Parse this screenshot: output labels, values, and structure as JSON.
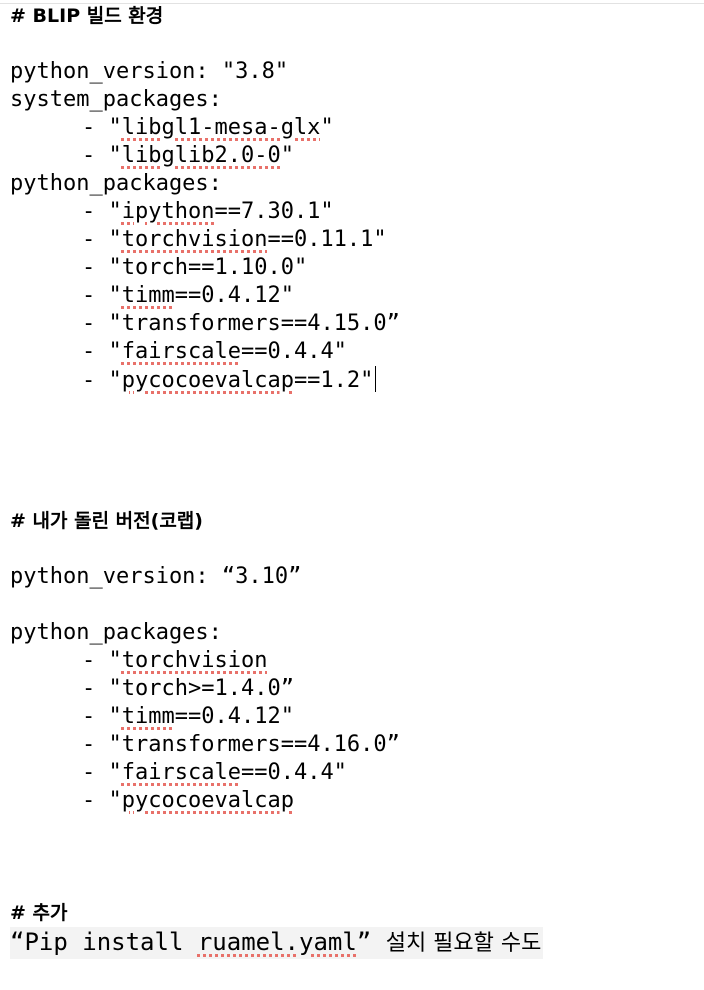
{
  "section1": {
    "heading": "# BLIP 빌드 환경",
    "python_version_line": "python_version: \"3.8\"",
    "system_packages_label": "system_packages:",
    "system_packages": [
      {
        "prefix": "- \"",
        "name": "libgl1-mesa-glx",
        "suffix": "\""
      },
      {
        "prefix": "- \"",
        "name": "libglib2.0-0",
        "suffix": "\""
      }
    ],
    "python_packages_label": "python_packages:",
    "python_packages": [
      {
        "prefix": "- \"",
        "name": "ipython",
        "suffix": "==7.30.1\""
      },
      {
        "prefix": "- \"",
        "name": "torchvision",
        "suffix": "==0.11.1\""
      },
      {
        "prefix": "- \"",
        "name": "torch",
        "suffix": "==1.10.0\""
      },
      {
        "prefix": "- \"",
        "name": "timm",
        "suffix": "==0.4.12\""
      },
      {
        "prefix": "- \"",
        "name": "transformers",
        "suffix": "==4.15.0”"
      },
      {
        "prefix": "- \"",
        "name": "fairscale",
        "suffix": "==0.4.4\""
      },
      {
        "prefix": "- \"",
        "name": "pycocoevalcap",
        "suffix": "==1.2\""
      }
    ]
  },
  "section2": {
    "heading": "# 내가 돌린 버전(코랩)",
    "python_version_line": "python_version: “3.10”",
    "python_packages_label": "python_packages:",
    "python_packages": [
      {
        "prefix": "- \"",
        "name": "torchvision",
        "suffix": ""
      },
      {
        "prefix": "- \"",
        "name": "torch",
        "suffix": ">=1.4.0”"
      },
      {
        "prefix": "- \"",
        "name": "timm",
        "suffix": "==0.4.12\""
      },
      {
        "prefix": "- \"",
        "name": "transformers",
        "suffix": "==4.16.0”"
      },
      {
        "prefix": "- \"",
        "name": "fairscale",
        "suffix": "==0.4.4\""
      },
      {
        "prefix": "- \"",
        "name": "pycocoevalcap",
        "suffix": ""
      }
    ]
  },
  "section3": {
    "heading": "# 추가",
    "note_open": "“Pip install ",
    "note_pkg": "ruamel.yaml",
    "note_close": "” ",
    "note_korean": "설치 필요할 수도"
  },
  "colors": {
    "spellcheck_underline": "#e8716a",
    "note_highlight": "#f3f3f3"
  }
}
